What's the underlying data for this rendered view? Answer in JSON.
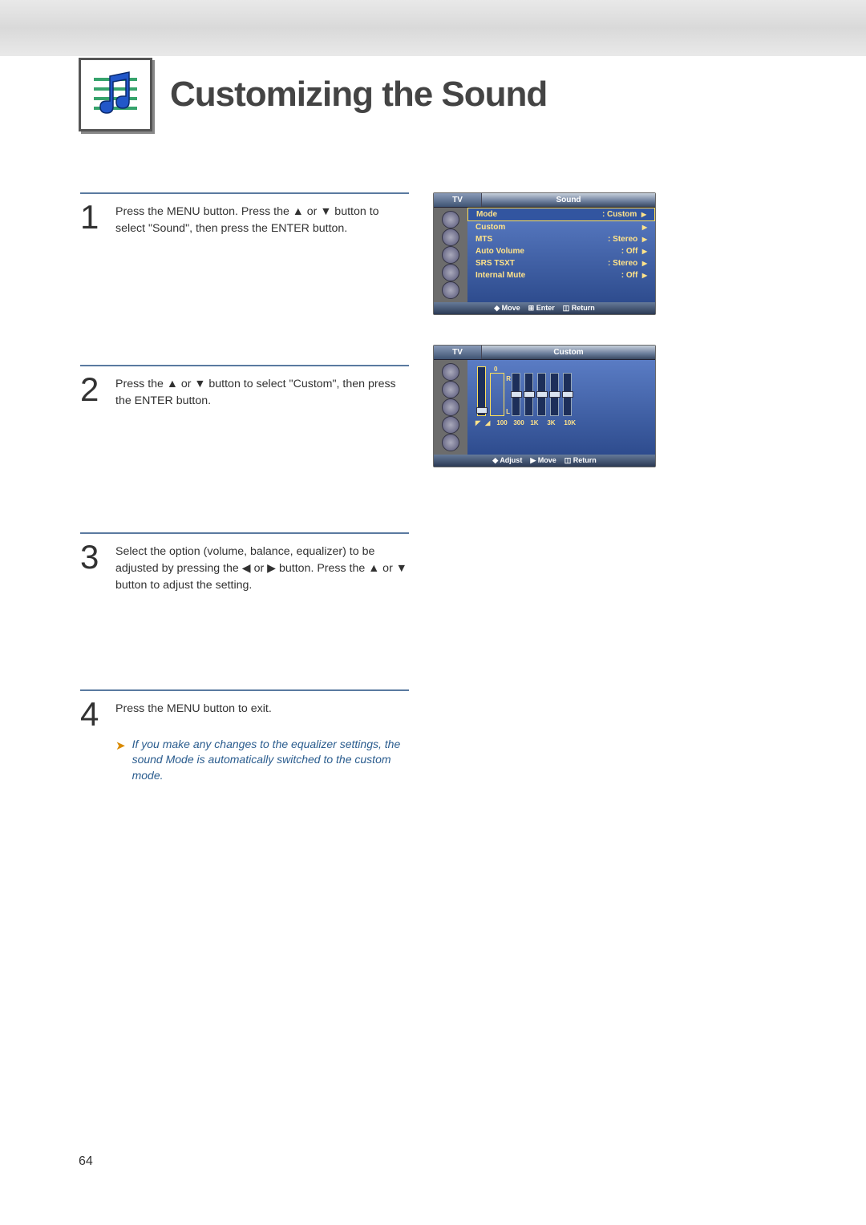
{
  "page": {
    "title": "Customizing the Sound",
    "number": "64"
  },
  "steps": [
    {
      "num": "1",
      "text": "Press the MENU button. Press the ▲ or ▼ button to select \"Sound\", then press the ENTER button."
    },
    {
      "num": "2",
      "text": "Press the ▲ or ▼ button to select \"Custom\", then press the ENTER button."
    },
    {
      "num": "3",
      "text": "Select the option (volume, balance, equalizer) to be adjusted by pressing the ◀ or ▶ button. Press the ▲ or ▼ button to adjust the setting."
    },
    {
      "num": "4",
      "text": "Press the MENU button to exit."
    }
  ],
  "note": "If you make any changes to the equalizer settings, the sound Mode is automatically switched to the custom mode.",
  "osd1": {
    "tab": "TV",
    "title": "Sound",
    "rows": [
      {
        "label": "Mode",
        "value": ": Custom",
        "sel": true
      },
      {
        "label": "Custom",
        "value": ""
      },
      {
        "label": "MTS",
        "value": ": Stereo"
      },
      {
        "label": "Auto Volume",
        "value": ": Off"
      },
      {
        "label": "SRS TSXT",
        "value": ": Stereo"
      },
      {
        "label": "Internal Mute",
        "value": ": Off"
      }
    ],
    "footer": [
      "Move",
      "Enter",
      "Return"
    ]
  },
  "osd2": {
    "tab": "TV",
    "title": "Custom",
    "balance": {
      "zero": "0",
      "r": "R",
      "l": "L"
    },
    "bands": [
      "100",
      "300",
      "1K",
      "3K",
      "10K"
    ],
    "nav": [
      "◤",
      "◢"
    ],
    "footer": [
      "Adjust",
      "Move",
      "Return"
    ]
  }
}
